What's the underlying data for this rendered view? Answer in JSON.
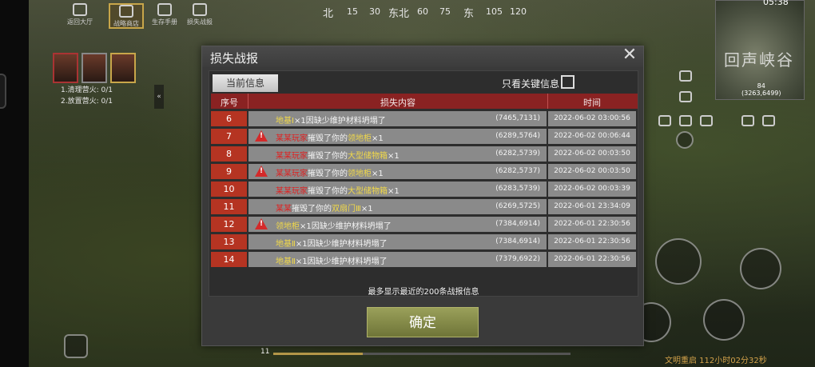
{
  "toolbar": {
    "items": [
      {
        "label": "返回大厅",
        "icon": "home-icon"
      },
      {
        "label": "战略商店",
        "icon": "shop-icon",
        "active": true
      },
      {
        "label": "生存手册",
        "icon": "book-icon"
      },
      {
        "label": "损失战报",
        "icon": "loss-report-icon"
      }
    ]
  },
  "compass": [
    "北",
    "15",
    "30",
    "东北",
    "60",
    "75",
    "东",
    "105",
    "120"
  ],
  "tasks": [
    "1.清理营火: 0/1",
    "2.放置营火: 0/1"
  ],
  "minimap": {
    "name": "回声峡谷",
    "distance": "84",
    "coord": "(3263,6499)"
  },
  "clock": "05:38",
  "dialog": {
    "title": "损失战报",
    "tab": "当前信息",
    "filter_label": "只看关键信息",
    "headers": {
      "num": "序号",
      "content": "损失内容",
      "time": "时间"
    },
    "rows": [
      {
        "num": "6",
        "warn": false,
        "name": "",
        "name_color": "none",
        "text": "地基Ⅰ×1因缺少维护材料坍塌了",
        "coord": "(7465,7131)",
        "time": "2022-06-02 03:00:56"
      },
      {
        "num": "7",
        "warn": true,
        "name": "某某玩家",
        "name_color": "red",
        "text": "摧毁了你的领地柜×1",
        "coord": "(6289,5764)",
        "time": "2022-06-02 00:06:44"
      },
      {
        "num": "8",
        "warn": false,
        "name": "某某玩家",
        "name_color": "red",
        "text": "摧毁了你的大型储物箱×1",
        "coord": "(6282,5739)",
        "time": "2022-06-02 00:03:50"
      },
      {
        "num": "9",
        "warn": true,
        "name": "某某玩家",
        "name_color": "red",
        "text": "摧毁了你的领地柜×1",
        "coord": "(6282,5737)",
        "time": "2022-06-02 00:03:50"
      },
      {
        "num": "10",
        "warn": false,
        "name": "某某玩家",
        "name_color": "red",
        "text": "摧毁了你的大型储物箱×1",
        "coord": "(6283,5739)",
        "time": "2022-06-02 00:03:39"
      },
      {
        "num": "11",
        "warn": false,
        "name": "某某",
        "name_color": "red",
        "text": "摧毁了你的双扇门Ⅲ×1",
        "coord": "(6269,5725)",
        "time": "2022-06-01 23:34:09"
      },
      {
        "num": "12",
        "warn": true,
        "name": "",
        "name_color": "none",
        "text": "领地柜×1因缺少维护材料坍塌了",
        "coord": "(7384,6914)",
        "time": "2022-06-01 22:30:56"
      },
      {
        "num": "13",
        "warn": false,
        "name": "",
        "name_color": "none",
        "text": "地基Ⅱ×1因缺少维护材料坍塌了",
        "coord": "(7384,6914)",
        "time": "2022-06-01 22:30:56"
      },
      {
        "num": "14",
        "warn": false,
        "name": "",
        "name_color": "none",
        "text": "地基Ⅱ×1因缺少维护材料坍塌了",
        "coord": "(7379,6922)",
        "time": "2022-06-01 22:30:56"
      }
    ],
    "footnote": "最多显示最近的200条战报信息",
    "confirm_label": "确定"
  },
  "status": {
    "level": "11",
    "xp_fraction": 0.3,
    "restart": "文明重启 112小时02分32秒"
  },
  "colors": {
    "accent_red": "#b53422",
    "highlight": "#f0d84a",
    "confirm_green": "#8a9048"
  }
}
